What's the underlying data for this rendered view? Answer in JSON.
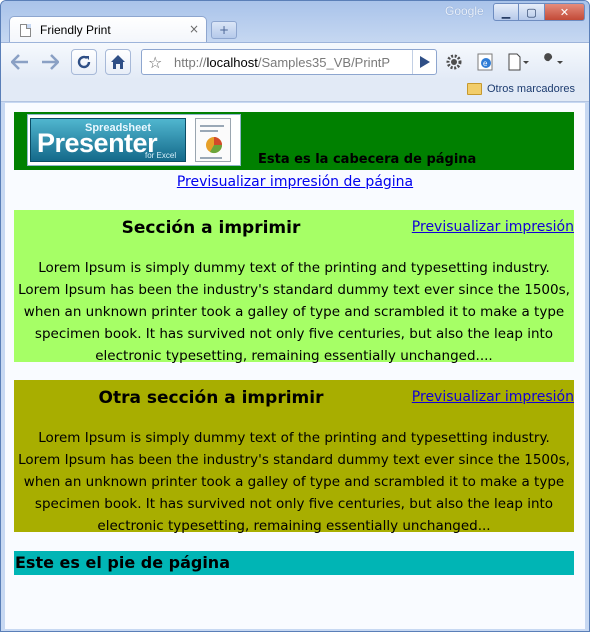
{
  "browser": {
    "brand": "Google",
    "tab": {
      "title": "Friendly Print",
      "close": "×"
    },
    "new_tab": "+",
    "address": {
      "prefix": "http://",
      "host": "localhost",
      "path": "/Samples35_VB/PrintP"
    },
    "bookmarks": {
      "item": "Otros marcadores"
    },
    "window_buttons": {
      "minimize": "▁",
      "maximize": "▢",
      "close": "✕"
    },
    "icons": [
      "back-icon",
      "forward-icon",
      "reload-icon",
      "home-icon",
      "star-icon",
      "go-icon",
      "extension-gear-icon",
      "ie-tab-icon",
      "page-menu-icon",
      "wrench-icon",
      "folder-icon"
    ]
  },
  "page": {
    "header": {
      "logo": {
        "small": "Spreadsheet",
        "big": "Presenter",
        "tiny": "for Excel"
      },
      "text": "Esta es la cabecera de página"
    },
    "preview_page_link": "Previsualizar impresión de página",
    "sections": [
      {
        "title": "Sección a imprimir",
        "link": "Previsualizar impresión",
        "body": "Lorem Ipsum is simply dummy text of the printing and typesetting industry. Lorem Ipsum has been the industry's standard dummy text ever since the 1500s, when an unknown printer took a galley of type and scrambled it to make a type specimen book. It has survived not only five centuries, but also the leap into electronic typesetting, remaining essentially unchanged....",
        "color": "#a6ff66"
      },
      {
        "title": "Otra sección a imprimir",
        "link": "Previsualizar impresión",
        "body": "Lorem Ipsum is simply dummy text of the printing and typesetting industry. Lorem Ipsum has been the industry's standard dummy text ever since the 1500s, when an unknown printer took a galley of type and scrambled it to make a type specimen book. It has survived not only five centuries, but also the leap into electronic typesetting, remaining essentially unchanged...",
        "color": "#a8ae00"
      }
    ],
    "footer": {
      "text": "Este es el pie de página",
      "color": "#00b5b5"
    },
    "header_color": "#008000"
  }
}
